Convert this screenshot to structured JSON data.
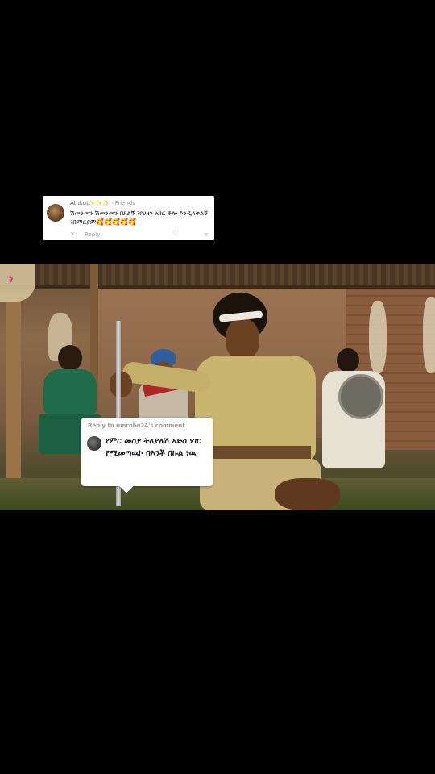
{
  "top_comment": {
    "author": "Atnkut",
    "author_suffix": "✨✨✨ · Friends",
    "text": "ሽመንመን ሽመንመን በደልኝ ፣የሀዘን አገር ቶሎ እንዲላቅልኝ ፣በማርያም🥰🥰🥰🥰🥰",
    "x_label": "×",
    "reply_label": "Reply",
    "like_icon": "heart-outline-icon",
    "dislike_icon": "thumbs-down-icon"
  },
  "video": {
    "logo_text": "ነ",
    "logo_icon": "channel-logo-icon"
  },
  "reply_sticker": {
    "reply_to": "Reply to umrobe24's comment",
    "text": "የምር መስያ ትለያለሽ አድስ ነገር የሚመጣዉኮ በእንቾ በኩል ነዉ"
  }
}
